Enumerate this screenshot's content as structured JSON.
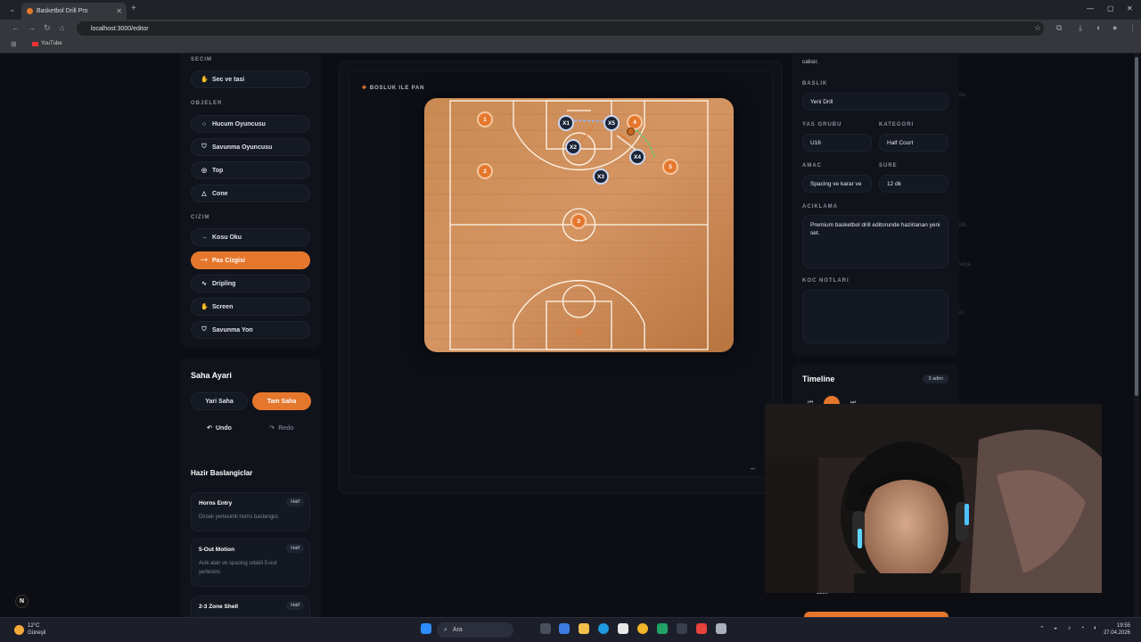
{
  "browser": {
    "tab_title": "Basketbol Drill Pro",
    "url": "localhost:3000/editor",
    "bookmark": "YouTube"
  },
  "left": {
    "secim_label": "SECIM",
    "sec_ve_tasi": "Sec ve tasi",
    "objeler_label": "OBJELER",
    "objeler": [
      "Hucum Oyuncusu",
      "Savunma Oyuncusu",
      "Top",
      "Cone"
    ],
    "cizim_label": "CIZIM",
    "cizim": [
      "Kosu Oku",
      "Pas Cizgisi",
      "Dripling",
      "Screen",
      "Savunma Yon"
    ],
    "active_tool": "Pas Cizgisi"
  },
  "saha": {
    "title": "Saha Ayari",
    "yari": "Yari Saha",
    "tam": "Tam Saha",
    "undo": "Undo",
    "redo": "Redo"
  },
  "hazir": {
    "title": "Hazir Baslangiclar",
    "presets": [
      {
        "name": "Horns Entry",
        "badge": "Half",
        "desc": "Dirsek yerlesimli horns baslangici."
      },
      {
        "name": "5-Out Motion",
        "badge": "Half",
        "desc": "Acik alan ve spacing odakli 5-out yerlesimi."
      },
      {
        "name": "2-3 Zone Shell",
        "badge": "Half",
        "desc": ""
      }
    ]
  },
  "canvas": {
    "pan_label": "BOSLUK ILE PAN",
    "minus": "–",
    "offense": [
      "1",
      "2",
      "3",
      "4",
      "5"
    ],
    "defense": [
      "X1",
      "X2",
      "X3",
      "X4",
      "X5"
    ]
  },
  "right": {
    "top_text": "calisir.",
    "baslik_label": "BASLIK",
    "baslik": "Yeni Drill",
    "yas_label": "YAS GRUBU",
    "yas": "U16",
    "kategori_label": "KATEGORI",
    "kategori": "Half Court",
    "amac_label": "AMAC",
    "amac": "Spacing ve karar ve",
    "sure_label": "SURE",
    "sure": "12 dk",
    "aciklama_label": "ACIKLAMA",
    "aciklama": "Premium basketbol drill editorunde hazirlanan yeni set.",
    "koc_label": "KOC NOTLARI",
    "koc": ""
  },
  "timeline": {
    "title": "Timeline",
    "steps": "3 adim",
    "ghost_value": "1280"
  },
  "ghost_right": [
    "da",
    "Ildi.",
    "veya",
    "ol"
  ],
  "taskbar": {
    "temp": "12°C",
    "weather": "Güneşli",
    "search": "Ara",
    "time": "19:55",
    "date": "27.04.2026"
  },
  "corner_badge": "N",
  "colors": {
    "accent": "#e5772d",
    "court_wood": "#c7874f",
    "defense": "#1b2436"
  }
}
